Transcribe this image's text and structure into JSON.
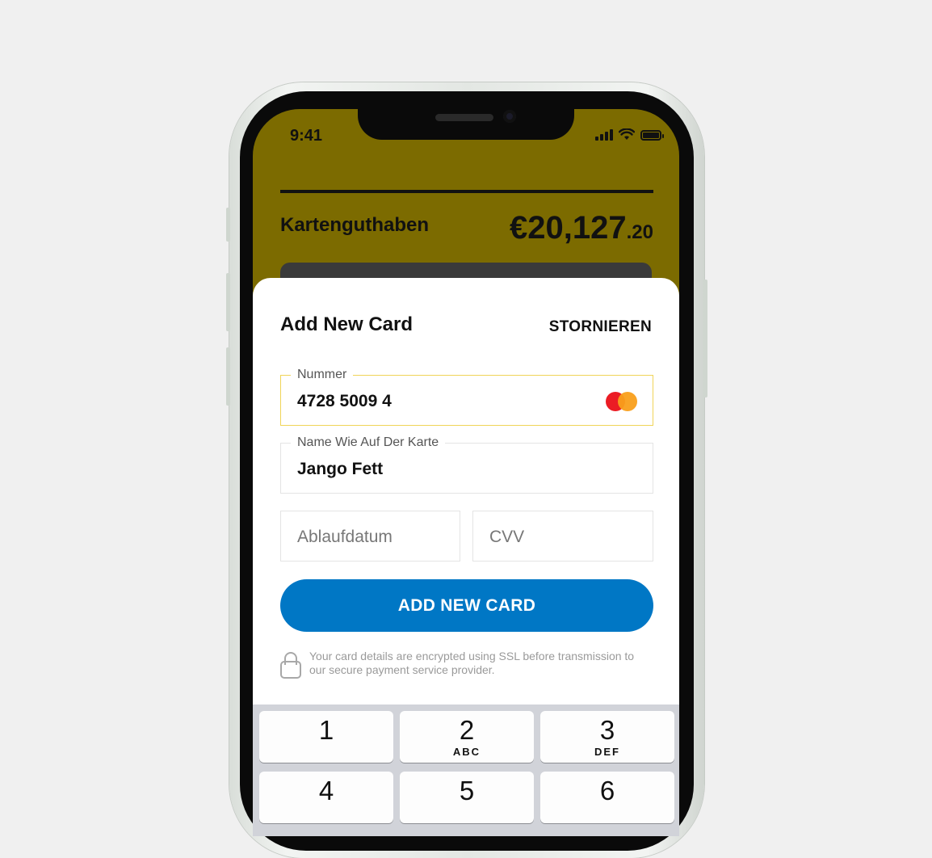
{
  "status_bar": {
    "time": "9:41"
  },
  "header": {
    "balance_label": "Kartenguthaben",
    "balance_major": "€20,127",
    "balance_minor": ".20"
  },
  "sheet": {
    "title": "Add New Card",
    "cancel_label": "STORNIEREN",
    "fields": {
      "number": {
        "label": "Nummer",
        "value": "4728 5009 4",
        "card_brand_icon": "mastercard-icon"
      },
      "name": {
        "label": "Name Wie Auf Der Karte",
        "value": "Jango Fett"
      },
      "expiry": {
        "placeholder": "Ablaufdatum"
      },
      "cvv": {
        "placeholder": "CVV"
      }
    },
    "submit_label": "ADD NEW CARD",
    "secure_note": "Your card details are encrypted using SSL before transmission to our secure payment service provider."
  },
  "keyboard": {
    "keys": [
      {
        "num": "1",
        "letters": ""
      },
      {
        "num": "2",
        "letters": "ABC"
      },
      {
        "num": "3",
        "letters": "DEF"
      },
      {
        "num": "4",
        "letters": ""
      },
      {
        "num": "5",
        "letters": ""
      },
      {
        "num": "6",
        "letters": ""
      }
    ]
  },
  "colors": {
    "header_background": "#7c6b00",
    "primary_button": "#0077c5",
    "active_field_border": "#f0d458",
    "mastercard_red": "#eb1c24",
    "mastercard_orange": "#f99f1b"
  }
}
